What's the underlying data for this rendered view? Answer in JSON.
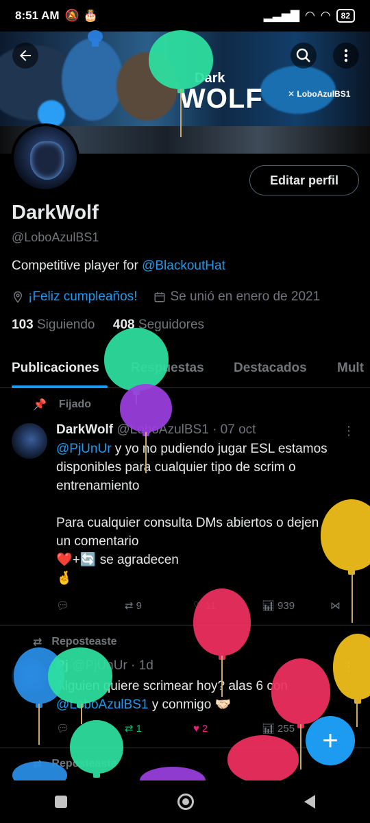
{
  "status_bar": {
    "time": "8:51 AM",
    "battery": "82"
  },
  "banner": {
    "title_small": "Dark",
    "title_big": "WOLF",
    "handle": "LoboAzulBS1"
  },
  "profile": {
    "edit_button": "Editar perfil",
    "name": "DarkWolf",
    "handle": "@LoboAzulBS1",
    "bio_text": "Competitive player for ",
    "bio_link": "@BlackoutHat",
    "birthday": "¡Feliz cumpleaños!",
    "joined": "Se unió en enero de 2021",
    "following_count": "103",
    "following_label": "Siguiendo",
    "followers_count": "408",
    "followers_label": "Seguidores"
  },
  "tabs": [
    "Publicaciones",
    "Respuestas",
    "Destacados",
    "Mult"
  ],
  "pinned": {
    "label": "Fijado",
    "name": "DarkWolf",
    "handle": "@LoboAzulBS1",
    "date": "· 07 oct",
    "text_link": "@PjUnUr",
    "text_line1": " y yo no pudiendo jugar ESL estamos",
    "text_line2": "disponibles para cualquier tipo de scrim o",
    "text_line3": "entrenamiento",
    "text_line4": "Para cualquier consulta DMs abiertos o dejen",
    "text_line5": "un comentario",
    "text_line6": "❤️+🔄 se agradecen",
    "text_line7": "🤞",
    "reposts": "9",
    "likes": "11",
    "views": "939"
  },
  "repost1": {
    "label": "Reposteaste",
    "name": "Pj",
    "handle": "@PjUnUr",
    "date": "· 1d",
    "text_line1": "Alguien quiere scrimear hoy? alas 6 con",
    "text_link": "@LoboAzulBS1",
    "text_line2_rest": " y conmigo 🤝🏻",
    "reposts": "1",
    "likes": "2",
    "views": "255"
  },
  "repost2": {
    "label": "Reposteaste"
  },
  "colors": {
    "accent": "#1d9bf0",
    "like": "#f91880",
    "repost": "#00ba7c"
  }
}
